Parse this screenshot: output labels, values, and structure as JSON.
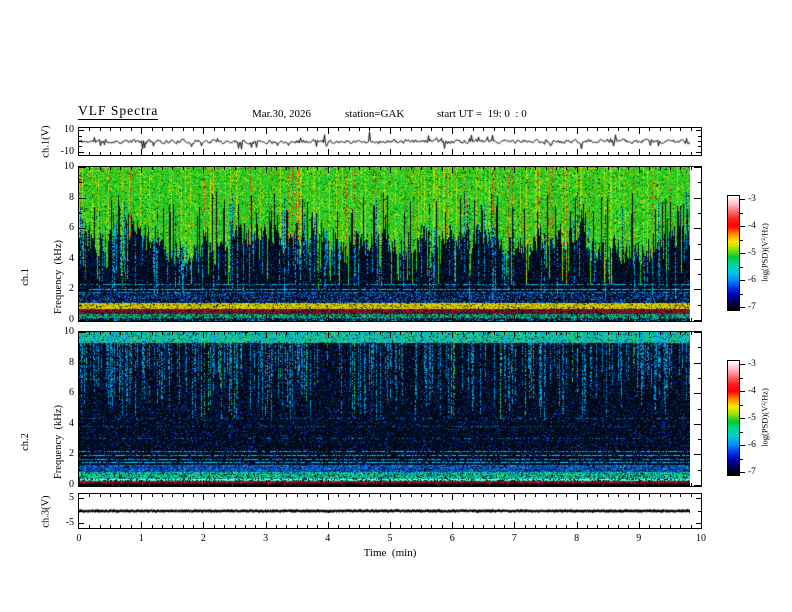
{
  "header": {
    "title": "VLF Spectra",
    "date": "Mar.30, 2026",
    "station": "station=GAK",
    "start_ut": "start UT =  19: 0  : 0"
  },
  "x_axis": {
    "label": "Time  (min)",
    "ticks": [
      "0",
      "1",
      "2",
      "3",
      "4",
      "5",
      "6",
      "7",
      "8",
      "9",
      "10"
    ],
    "min": 0,
    "max": 10,
    "data_end_min": 9.82
  },
  "colorbar": {
    "label": "log(PSD)(V²/Hz)",
    "ticks": [
      "-3",
      "-4",
      "-5",
      "-6",
      "-7"
    ],
    "range": [
      -3,
      -7
    ],
    "gradient": [
      "#ffffff",
      "#ffc2cc",
      "#ff7078",
      "#ff2020",
      "#ff0000",
      "#ff8800",
      "#ffe800",
      "#98e000",
      "#00cc30",
      "#00d8a0",
      "#00c8d8",
      "#0090ff",
      "#0038e8",
      "#0000b0",
      "#000050",
      "#000000"
    ]
  },
  "panels": {
    "ch1_wave": {
      "ylabel": "ch.1(V)",
      "yticks": [
        "10",
        "-10"
      ],
      "ylim": [
        -12,
        12
      ]
    },
    "ch1_spec": {
      "ylabel1": "ch.1",
      "ylabel2": "Frequency  (kHz)",
      "yticks": [
        "10",
        "8",
        "6",
        "4",
        "2",
        "0"
      ],
      "ylim": [
        0,
        10
      ]
    },
    "ch2_spec": {
      "ylabel1": "ch.2",
      "ylabel2": "Frequency  (kHz)",
      "yticks": [
        "10",
        "8",
        "6",
        "4",
        "2",
        "0"
      ],
      "ylim": [
        0,
        10
      ]
    },
    "ch3_wave": {
      "ylabel": "ch.3(V)",
      "yticks": [
        "5",
        "-5"
      ],
      "ylim": [
        -6.8,
        6.8
      ]
    }
  },
  "chart_data": [
    {
      "type": "line",
      "id": "ch1_waveform",
      "title": "ch.1 voltage trace",
      "xlabel": "Time (min)",
      "ylabel": "ch.1(V)",
      "xlim": [
        0,
        10
      ],
      "ylim": [
        -12,
        12
      ],
      "yticks": [
        10,
        -10
      ],
      "description": "Dense black noise trace centered near 0 V, peak-to-peak about 4 V, with impulsive vertical spikes reaching about +/-9 V; data ends near 9.82 min.",
      "render": {
        "seed": 11,
        "smooth": 0.45,
        "amp": 1.7,
        "spike_p": 0.06,
        "spike_amp": [
          2,
          5
        ],
        "big_spike_p": 0.012,
        "big_spike_amp": [
          5,
          9
        ]
      }
    },
    {
      "type": "heatmap",
      "id": "ch1_spectrogram",
      "title": "ch.1 VLF spectrogram",
      "xlabel": "Time (min)",
      "ylabel": "ch.1 Frequency (kHz)",
      "xlim": [
        0,
        10
      ],
      "ylim": [
        0,
        10
      ],
      "zlabel": "log(PSD)(V²/Hz)",
      "zlim": [
        -7,
        -3
      ],
      "description": "Strong broadband hiss (green/yellow, ~-4.5) above ~5 kHz with red sferic streaks (~-3.5); dark background (~-7) below 5 kHz with blue noise; cyan lines near 2 kHz; intense yellow band 0.8-1.1 kHz (~-4); maroon band 0.4-0.7 kHz; teal band 0.15-0.4 kHz.",
      "render": {
        "seed": 42,
        "bands": [
          {
            "kind": "base",
            "color": "#000a18"
          },
          {
            "kind": "speckle",
            "f": [
              0,
              10
            ],
            "p": 0.1,
            "colors": [
              "#0d35b5",
              "#0a2a90",
              "#1545d0"
            ]
          },
          {
            "kind": "speckle",
            "f": [
              1.1,
              1.8
            ],
            "p": 0.3,
            "colors": [
              "#1458e0",
              "#0a3cb8",
              "#00a0e0"
            ]
          },
          {
            "kind": "canopy",
            "base_depth": 4.6,
            "wedge_p": 0.13,
            "deep_p": 0.1,
            "red_col_p": 0.075,
            "yellow_col_p": 0.14,
            "tail_p": 0.28,
            "tail_f": [
              1.3,
              4.8
            ],
            "tail_fill": 0.55,
            "tail_color": "#00b4ec",
            "green_tail_p": 0.06,
            "colors": {
              "green": [
                "#1fc41f",
                "#2ed32e",
                "#18b818"
              ],
              "yellow": [
                "#b4d400",
                "#d0dc00"
              ],
              "bright": "#52e852",
              "dark": "#013801",
              "red": [
                "#e03000",
                "#ff5a00",
                "#c02000"
              ]
            }
          },
          {
            "kind": "hline",
            "f": 2.35,
            "fill": 0.55,
            "color": "#00c4f8"
          },
          {
            "kind": "hline",
            "f": 2.05,
            "fill": 0.7,
            "color": "#00d0ff"
          },
          {
            "kind": "hline",
            "f": 1.8,
            "fill": 0.4,
            "color": "#0098e0"
          },
          {
            "kind": "band",
            "f": [
              0.78,
              1.08
            ],
            "colors": [
              [
                "#d4d400",
                0.58
              ],
              [
                "#e8b400",
                0.14
              ],
              [
                "#989800",
                0.14
              ],
              [
                "#604400",
                0.07
              ]
            ]
          },
          {
            "kind": "hline",
            "f": 0.74,
            "fill": 0.85,
            "color": "#cc2800"
          },
          {
            "kind": "band",
            "f": [
              0.4,
              0.7
            ],
            "colors": [
              [
                "#8c1220",
                0.34
              ],
              [
                "#6a1040",
                0.18
              ],
              [
                "#b02410",
                0.12
              ],
              [
                "#30081c",
                0.26
              ]
            ]
          },
          {
            "kind": "band",
            "f": [
              0.14,
              0.4
            ],
            "colors": [
              [
                "#00b487",
                0.4
              ],
              [
                "#00dca5",
                0.16
              ],
              [
                "#007a58",
                0.16
              ],
              [
                "#02231c",
                0.18
              ]
            ]
          },
          {
            "kind": "band",
            "f": [
              0,
              0.14
            ],
            "colors": [
              [
                "#001428",
                0.55
              ],
              [
                "#00b8e0",
                0.22
              ]
            ]
          }
        ]
      }
    },
    {
      "type": "heatmap",
      "id": "ch2_spectrogram",
      "title": "ch.2 VLF spectrogram",
      "xlabel": "Time (min)",
      "ylabel": "ch.2 Frequency (kHz)",
      "xlim": [
        0,
        10
      ],
      "ylim": [
        0,
        10
      ],
      "zlabel": "log(PSD)(V²/Hz)",
      "zlim": [
        -7,
        -3
      ],
      "description": "Mostly dark (~-7) with dense cyan/green sferic streaks descending from a green band at 9.4-10 kHz to 4-7 kHz; faint cyan lines 3-4.4 kHz; cluster of cyan lines 1.3-2.2 kHz; teal band 0.45-0.9 kHz; dark-red band near 0.2 kHz.",
      "render": {
        "seed": 77,
        "bands": [
          {
            "kind": "base",
            "color": "#000a18"
          },
          {
            "kind": "speckle",
            "f": [
              0,
              10
            ],
            "p": 0.13,
            "colors": [
              "#0d35b5",
              "#0a2a90",
              "#1243cc"
            ]
          },
          {
            "kind": "band",
            "f": [
              9.35,
              10
            ],
            "colors": [
              [
                "#16c878",
                0.4
              ],
              [
                "#2ad88e",
                0.22
              ],
              [
                "#12b4c8",
                0.2
              ],
              [
                "#0c6a94",
                0.1
              ]
            ]
          },
          {
            "kind": "vstreaks",
            "p": 0.34,
            "depth": [
              2.2,
              5.8
            ],
            "fill": 0.5,
            "color": "#00a6e4",
            "green_p": 0.1,
            "green_color": "#2cd464",
            "red_p": 0.005,
            "red_color": "#d84010"
          },
          {
            "kind": "hline",
            "f": 4.35,
            "fill": 0.22,
            "color": "#0090d8"
          },
          {
            "kind": "hline",
            "f": 3.85,
            "fill": 0.2,
            "color": "#0084cc"
          },
          {
            "kind": "hline",
            "f": 3.05,
            "fill": 0.22,
            "color": "#0090d8"
          },
          {
            "kind": "hline",
            "f": 2.2,
            "fill": 0.55,
            "color": "#00c0f0"
          },
          {
            "kind": "hline",
            "f": 1.95,
            "fill": 0.6,
            "color": "#00ccf8"
          },
          {
            "kind": "hline",
            "f": 1.72,
            "fill": 0.55,
            "color": "#00c0f0"
          },
          {
            "kind": "hline",
            "f": 1.5,
            "fill": 0.65,
            "color": "#00d4ff"
          },
          {
            "kind": "hline",
            "f": 1.33,
            "fill": 0.5,
            "color": "#00b8ec"
          },
          {
            "kind": "band",
            "f": [
              0.88,
              1.3
            ],
            "colors": [
              [
                "#0a58d8",
                0.4
              ],
              [
                "#00a0e8",
                0.18
              ],
              [
                "#062a70",
                0.2
              ]
            ]
          },
          {
            "kind": "band",
            "f": [
              0.45,
              0.88
            ],
            "colors": [
              [
                "#00c890",
                0.45
              ],
              [
                "#32e0a8",
                0.18
              ],
              [
                "#00a0c0",
                0.12
              ],
              [
                "#024028",
                0.12
              ]
            ]
          },
          {
            "kind": "hline",
            "f": 0.4,
            "fill": 0.75,
            "color": "#8cf8f8"
          },
          {
            "kind": "hline",
            "f": 0.33,
            "fill": 0.65,
            "color": "#50e8e8"
          },
          {
            "kind": "band",
            "f": [
              0.1,
              0.26
            ],
            "colors": [
              [
                "#a01008",
                0.5
              ],
              [
                "#d42810",
                0.18
              ],
              [
                "#500404",
                0.26
              ]
            ]
          },
          {
            "kind": "band",
            "f": [
              0,
              0.1
            ],
            "colors": [
              [
                "#000810",
                0.8
              ],
              [
                "#c03008",
                0.05
              ]
            ]
          }
        ]
      }
    },
    {
      "type": "line",
      "id": "ch3_waveform",
      "title": "ch.3 voltage trace",
      "xlabel": "Time (min)",
      "ylabel": "ch.3(V)",
      "xlim": [
        0,
        10
      ],
      "ylim": [
        -6.8,
        6.8
      ],
      "yticks": [
        5,
        -5
      ],
      "description": "Flat thick black trace constant at 0 V for the whole record, ending near 9.82 min.",
      "render": {
        "seed": 5,
        "value": 0,
        "jitter": 0.5,
        "thickness": 2.6
      }
    }
  ]
}
